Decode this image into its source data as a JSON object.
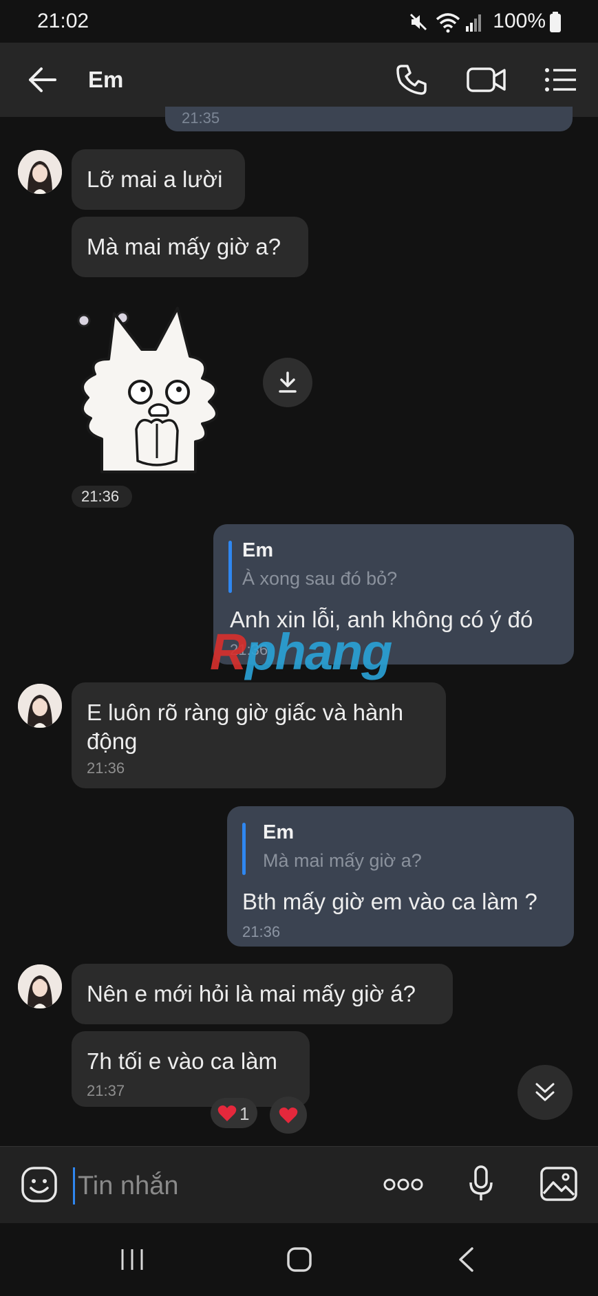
{
  "status": {
    "time": "21:02",
    "battery": "100%"
  },
  "header": {
    "title": "Em"
  },
  "previous_fragment": {
    "time": "21:35"
  },
  "messages": [
    {
      "text": "Lỡ mai a lười"
    },
    {
      "text": "Mà mai mấy giờ a?"
    },
    {
      "time": "21:36"
    },
    {
      "quote_name": "Em",
      "quote_text": "À xong sau đó bỏ?",
      "text": "Anh xin lỗi, anh không có ý đó",
      "time": "21:36"
    },
    {
      "text": "E luôn rõ ràng giờ giấc và hành\nđộng",
      "time": "21:36"
    },
    {
      "quote_name": "Em",
      "quote_text": "Mà mai mấy giờ a?",
      "text": "Bth mấy giờ em vào ca làm ?",
      "time": "21:36"
    },
    {
      "text": "Nên e mới hỏi là mai mấy giờ á?"
    },
    {
      "text": "7h tối e vào ca làm",
      "time": "21:37",
      "reaction_count": "1"
    }
  ],
  "input": {
    "placeholder": "Tin nhắn"
  },
  "watermark": {
    "first": "R",
    "rest": "phang"
  },
  "icons": {
    "back": "back-arrow-icon",
    "call": "phone-icon",
    "video": "video-camera-icon",
    "menu": "menu-list-icon",
    "download": "download-icon",
    "scroll_down": "double-chevron-down-icon",
    "emoji": "emoji-icon",
    "more": "more-dots-icon",
    "mic": "microphone-icon",
    "gallery": "image-gallery-icon",
    "reaction": "heart-icon",
    "sticker": "cat-sticker"
  },
  "colors": {
    "accent": "#2f87f0",
    "incoming_bubble": "#2b2b2b",
    "outgoing_bubble": "#3b4351",
    "heart": "#e5283c"
  }
}
